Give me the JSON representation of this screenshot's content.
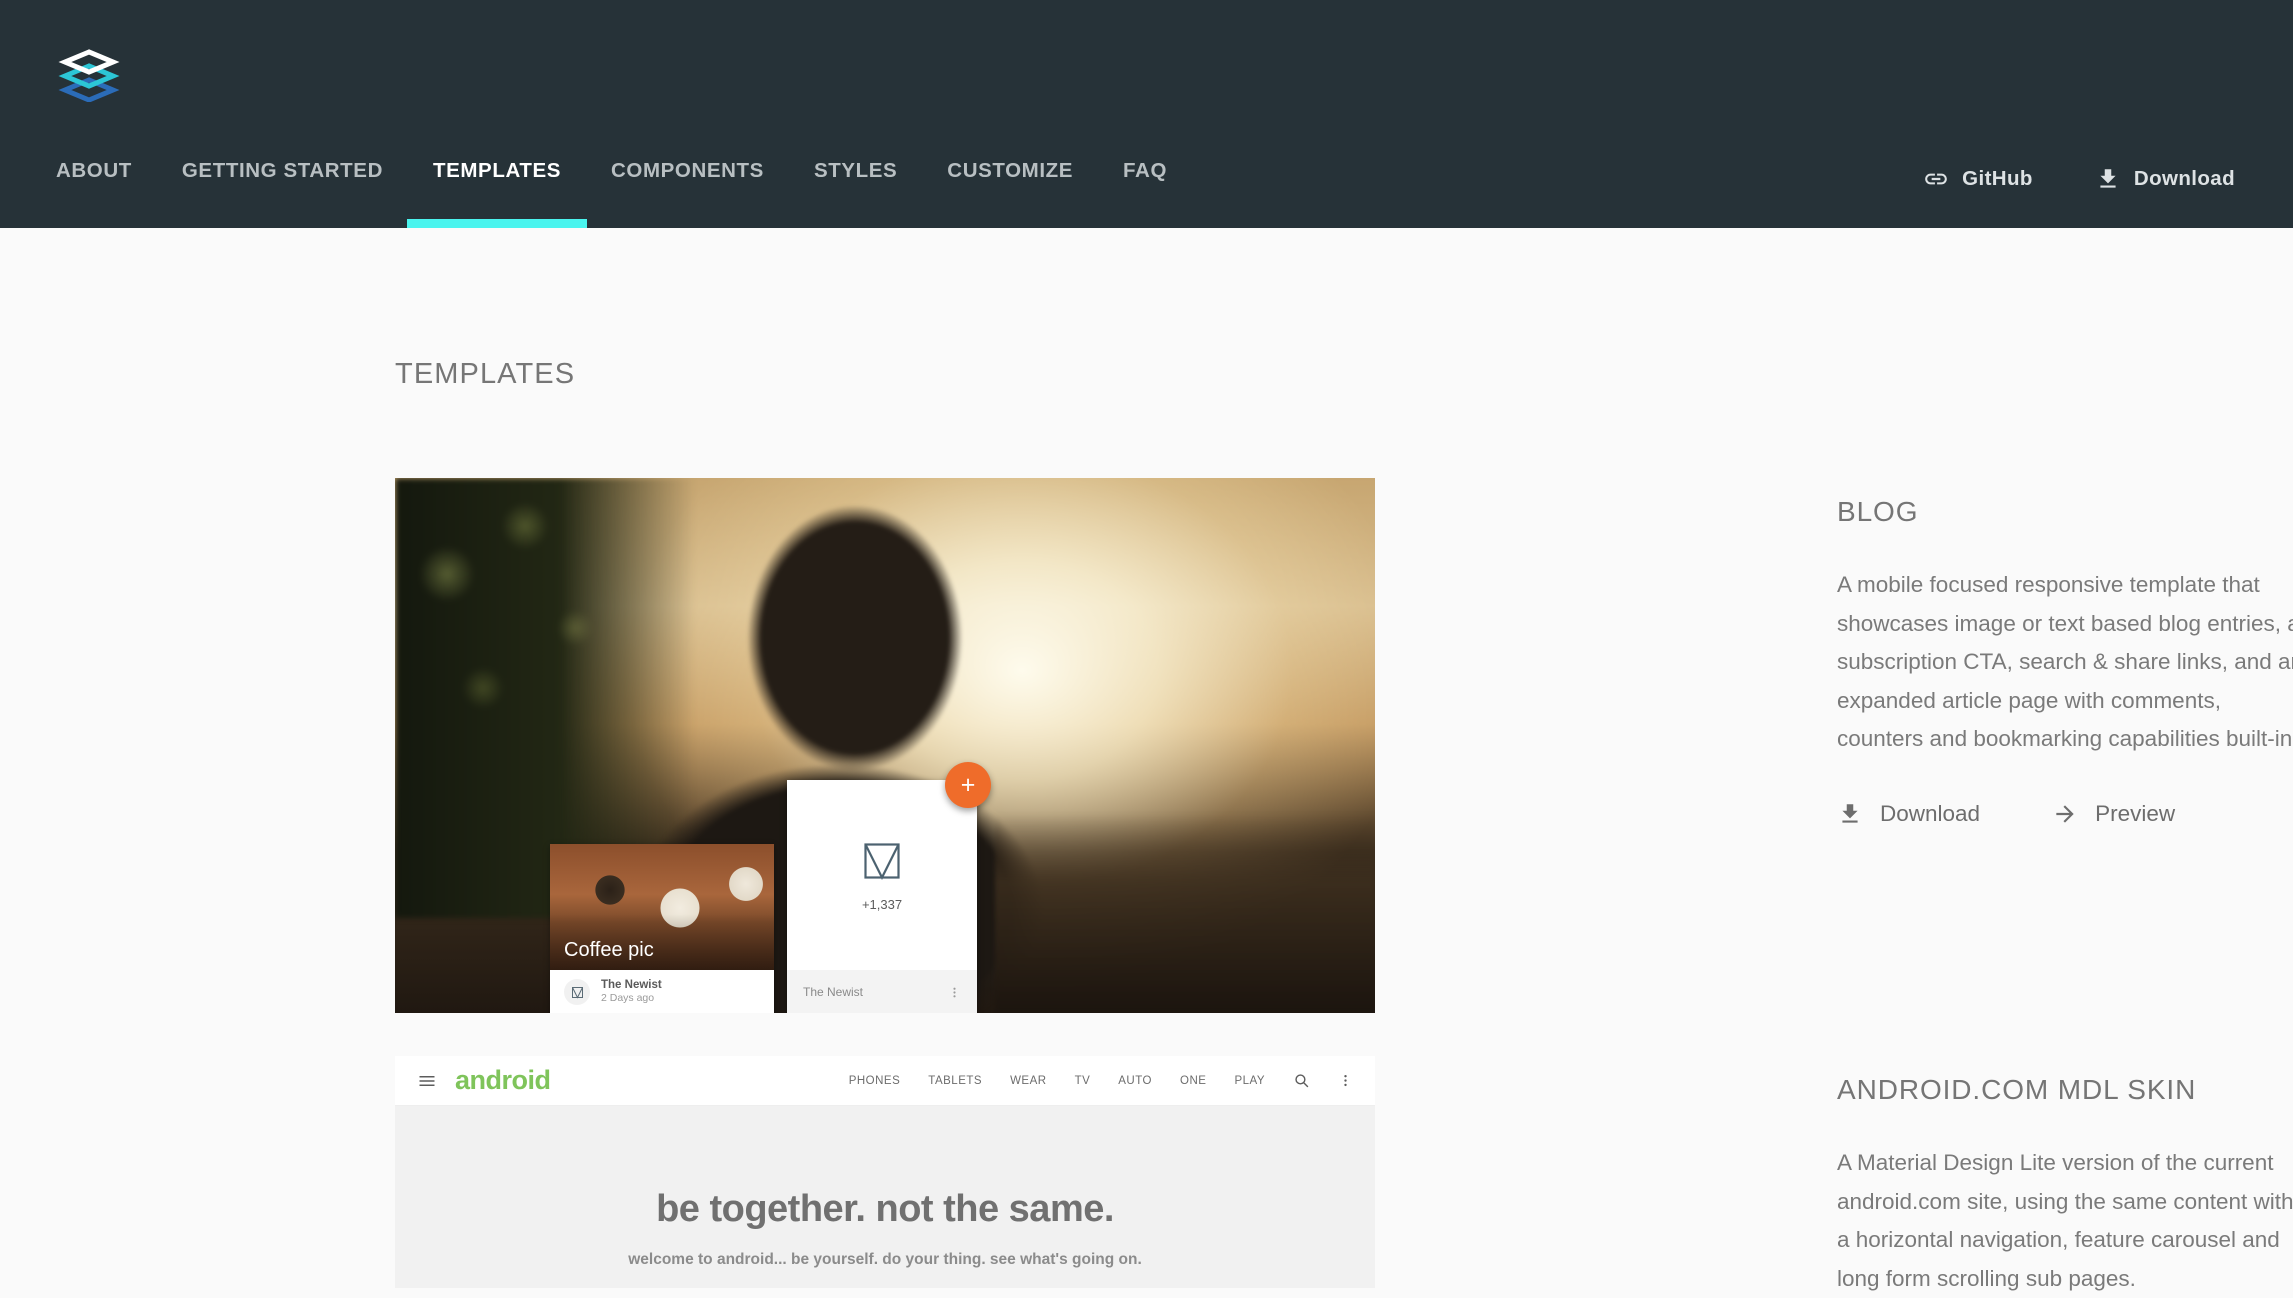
{
  "header": {
    "logo_icon": "mdl-layers-logo",
    "nav_items": [
      {
        "label": "ABOUT",
        "active": false
      },
      {
        "label": "GETTING STARTED",
        "active": false
      },
      {
        "label": "TEMPLATES",
        "active": true
      },
      {
        "label": "COMPONENTS",
        "active": false
      },
      {
        "label": "STYLES",
        "active": false
      },
      {
        "label": "CUSTOMIZE",
        "active": false
      },
      {
        "label": "FAQ",
        "active": false
      }
    ],
    "github_label": "GitHub",
    "github_icon": "link-icon",
    "download_label": "Download",
    "download_icon": "download-icon",
    "bg_color": "#263238",
    "accent_color": "#4af4ee"
  },
  "page": {
    "title": "TEMPLATES",
    "bg_color": "#fafafa"
  },
  "templates": [
    {
      "name": "BLOG",
      "description": "A mobile focused responsive template that showcases image or text based blog entries, a subscription CTA, search & share links, and an expanded article page with comments, counters and bookmarking capabilities built-in.",
      "download_label": "Download",
      "download_icon": "download-icon",
      "preview_label": "Preview",
      "preview_icon": "arrow-forward-icon",
      "preview_art": {
        "card_a": {
          "title": "Coffee pic",
          "author": "The Newist",
          "timestamp": "2 Days ago",
          "avatar_icon": "newist-logo-icon"
        },
        "card_b": {
          "count": "+1,337",
          "author": "The Newist",
          "logo_icon": "newist-logo-icon",
          "more_icon": "more-vert-icon"
        },
        "fab": {
          "icon": "plus-icon",
          "label": "+",
          "color": "#ef6c2a"
        }
      }
    },
    {
      "name": "ANDROID.COM MDL SKIN",
      "description": "A Material Design Lite version of the current android.com site, using the same content with a horizontal navigation, feature carousel and long form scrolling sub pages.",
      "preview_art": {
        "menu_icon": "hamburger-menu-icon",
        "brand": "android",
        "brand_color": "#7fc45b",
        "nav": [
          "PHONES",
          "TABLETS",
          "WEAR",
          "TV",
          "AUTO",
          "ONE",
          "PLAY"
        ],
        "search_icon": "search-icon",
        "more_icon": "more-vert-icon",
        "headline": "be together. not the same.",
        "subhead": "welcome to android... be yourself. do your thing. see what's going on."
      }
    }
  ]
}
